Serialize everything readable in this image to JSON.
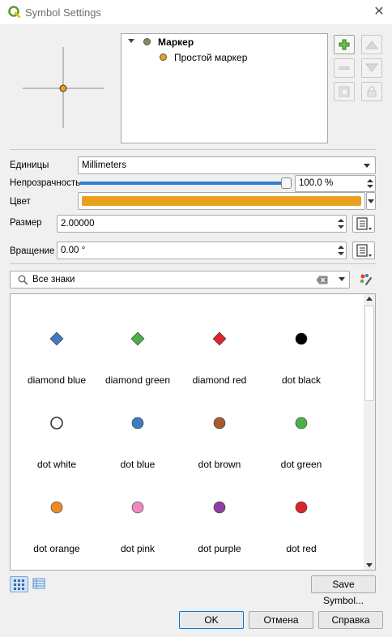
{
  "window": {
    "title": "Symbol Settings"
  },
  "layer_tree": {
    "root_label": "Маркер",
    "child_label": "Простой маркер",
    "root_color": "#8a8a5a",
    "child_color": "#e8a020"
  },
  "side_tools": [
    "add-layer-icon",
    "move-up-icon",
    "remove-layer-icon",
    "move-down-icon",
    "duplicate-layer-icon",
    "lock-icon"
  ],
  "form": {
    "units_label": "Единицы",
    "units_value": "Millimeters",
    "opacity_label": "Непрозрачность",
    "opacity_value": "100.0 %",
    "opacity_fraction": 1.0,
    "color_label": "Цвет",
    "color_value": "#e8a020",
    "size_label": "Размер",
    "size_value": "2.00000",
    "rotation_label": "Вращение",
    "rotation_value": "0.00 °"
  },
  "search": {
    "value": "Все знаки"
  },
  "symbols": [
    {
      "name": "diamond blue",
      "shape": "diamond",
      "color": "#3f7bc1"
    },
    {
      "name": "diamond green",
      "shape": "diamond",
      "color": "#4cb04a"
    },
    {
      "name": "diamond red",
      "shape": "diamond",
      "color": "#d9262c"
    },
    {
      "name": "dot  black",
      "shape": "dot",
      "color": "#000000"
    },
    {
      "name": "dot  white",
      "shape": "dot",
      "color": "#ffffff"
    },
    {
      "name": "dot blue",
      "shape": "dot",
      "color": "#3f7bc1"
    },
    {
      "name": "dot brown",
      "shape": "dot",
      "color": "#a85a2e"
    },
    {
      "name": "dot green",
      "shape": "dot",
      "color": "#4cb04a"
    },
    {
      "name": "dot orange",
      "shape": "dot",
      "color": "#ef8a1f"
    },
    {
      "name": "dot pink",
      "shape": "dot",
      "color": "#ef86c0"
    },
    {
      "name": "dot purple",
      "shape": "dot",
      "color": "#8e3fa5"
    },
    {
      "name": "dot red",
      "shape": "dot",
      "color": "#d9262c"
    }
  ],
  "buttons": {
    "save_symbol": "Save Symbol...",
    "ok": "OK",
    "cancel": "Отмена",
    "help": "Справка"
  }
}
